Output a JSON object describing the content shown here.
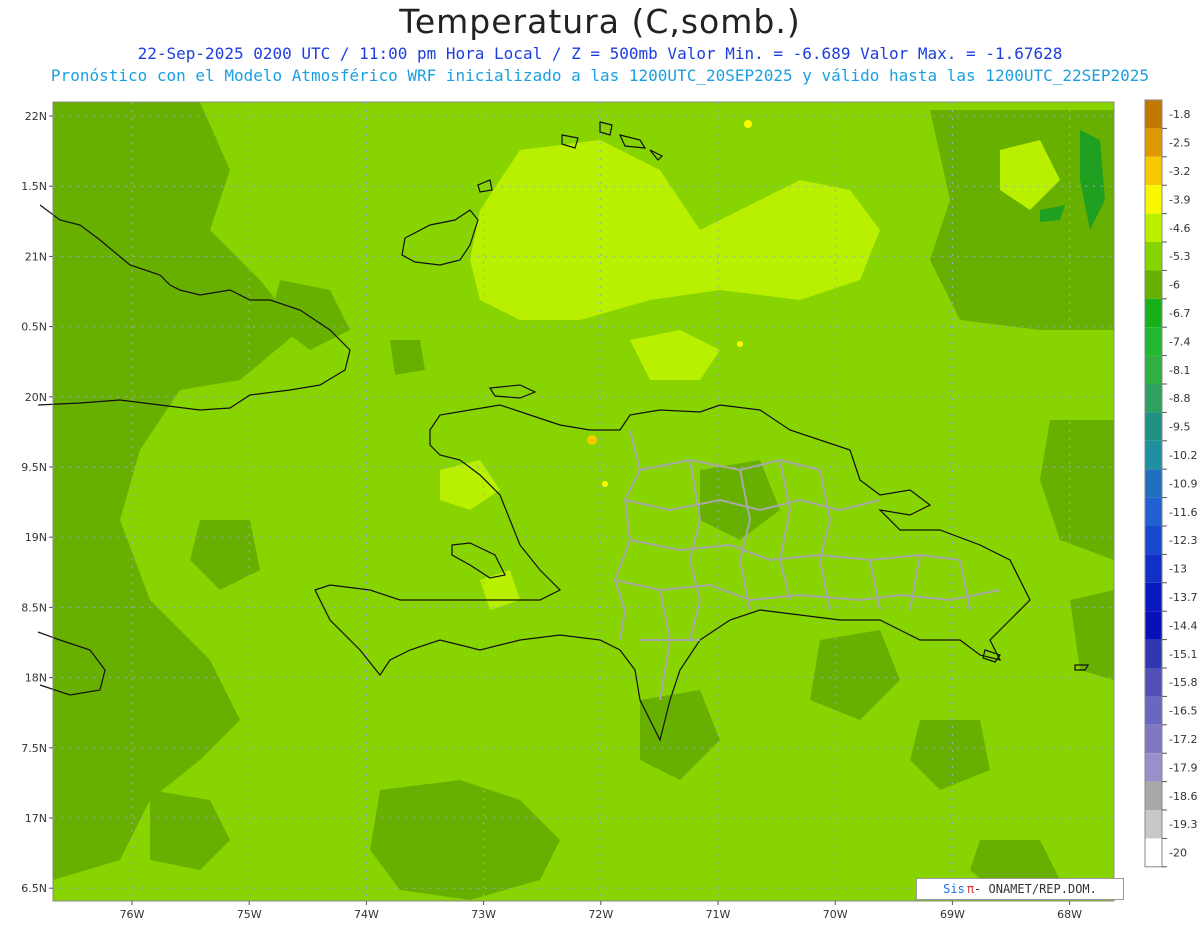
{
  "header": {
    "title": "Temperatura (C,somb.)",
    "line1": "22-Sep-2025 0200 UTC / 11:00 pm Hora Local / Z = 500mb   Valor Min. = -6.689  Valor Max. = -1.67628",
    "line2": "Pronóstico con el Modelo Atmosférico WRF inicializado a las 1200UTC_20SEP2025 y válido hasta las  1200UTC_22SEP2025"
  },
  "axes": {
    "lat_labels": [
      "22N",
      "1.5N",
      "21N",
      "0.5N",
      "20N",
      "9.5N",
      "19N",
      "8.5N",
      "18N",
      "7.5N",
      "17N",
      "6.5N"
    ],
    "lon_labels": [
      "76W",
      "75W",
      "74W",
      "73W",
      "72W",
      "71W",
      "70W",
      "69W",
      "68W"
    ]
  },
  "legend": {
    "levels": [
      "-1.8",
      "-2.5",
      "-3.2",
      "-3.9",
      "-4.6",
      "-5.3",
      "-6",
      "-6.7",
      "-7.4",
      "-8.1",
      "-8.8",
      "-9.5",
      "-10.2",
      "-10.9",
      "-11.6",
      "-12.3",
      "-13",
      "-13.7",
      "-14.4",
      "-15.1",
      "-15.8",
      "-16.5",
      "-17.2",
      "-17.9",
      "-18.6",
      "-19.3",
      "-20"
    ],
    "colors": [
      "#c07800",
      "#e09800",
      "#f8c800",
      "#f8f800",
      "#b8f000",
      "#88d400",
      "#68b000",
      "#18b018",
      "#20b830",
      "#30b040",
      "#30a060",
      "#209080",
      "#2090a0",
      "#2070c0",
      "#2060d0",
      "#1848d0",
      "#1030c8",
      "#0818c0",
      "#0810b8",
      "#3038b0",
      "#5050b8",
      "#6868c0",
      "#8078c0",
      "#9890c8",
      "#a8a8a8",
      "#c8c8c8",
      "#ffffff"
    ]
  },
  "credit": {
    "brand": "Sis",
    "pi": "π",
    "text": " - ONAMET/REP.DOM."
  },
  "colors": {
    "light_green": "#88d400",
    "dark_green": "#68b000",
    "yellow_green": "#b8f000"
  }
}
